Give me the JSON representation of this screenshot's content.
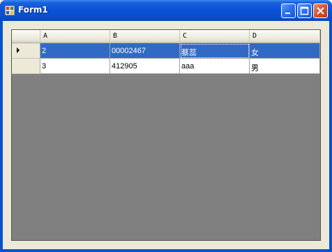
{
  "window": {
    "title": "Form1"
  },
  "grid": {
    "columns": [
      "A",
      "B",
      "C",
      "D"
    ],
    "rows": [
      {
        "cells": [
          "2",
          "00002467",
          "蔡蕊",
          "女"
        ],
        "selected": true
      },
      {
        "cells": [
          "3",
          "412905",
          "aaa",
          "男"
        ],
        "selected": false
      }
    ]
  },
  "colors": {
    "title_bar": "#0a53d6",
    "selection": "#316ac5",
    "grid_background": "#808080"
  }
}
